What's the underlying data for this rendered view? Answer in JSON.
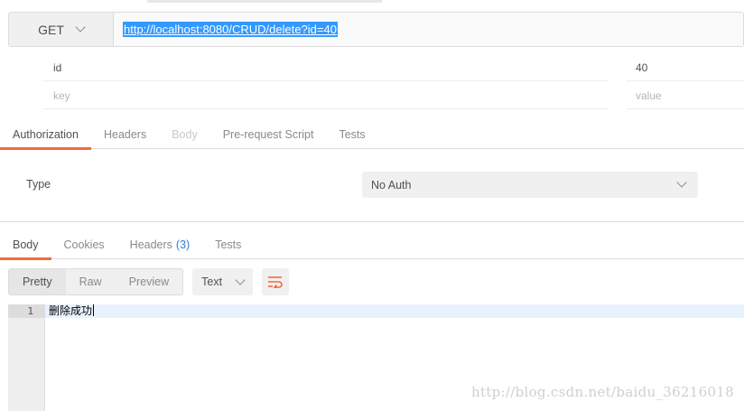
{
  "request": {
    "method": "GET",
    "url": "http://localhost:8080/CRUD/delete?id=40"
  },
  "params": [
    {
      "key": "id",
      "value": "40"
    }
  ],
  "params_placeholder": {
    "key": "key",
    "value": "value"
  },
  "request_tabs": [
    {
      "label": "Authorization",
      "state": "active"
    },
    {
      "label": "Headers",
      "state": "normal"
    },
    {
      "label": "Body",
      "state": "disabled"
    },
    {
      "label": "Pre-request Script",
      "state": "normal"
    },
    {
      "label": "Tests",
      "state": "normal"
    }
  ],
  "auth": {
    "type_label": "Type",
    "selected": "No Auth"
  },
  "response_tabs": {
    "body": "Body",
    "cookies": "Cookies",
    "headers": "Headers",
    "headers_count": "(3)",
    "tests": "Tests"
  },
  "response_toolbar": {
    "views": [
      "Pretty",
      "Raw",
      "Preview"
    ],
    "active_view": "Pretty",
    "format": "Text"
  },
  "response_body": {
    "lines": [
      {
        "number": "1",
        "text": "删除成功"
      }
    ]
  },
  "watermark": "http://blog.csdn.net/baidu_36216018",
  "colors": {
    "accent": "#f26b3a",
    "selection": "#3399ff",
    "count": "#2d7fd3"
  }
}
